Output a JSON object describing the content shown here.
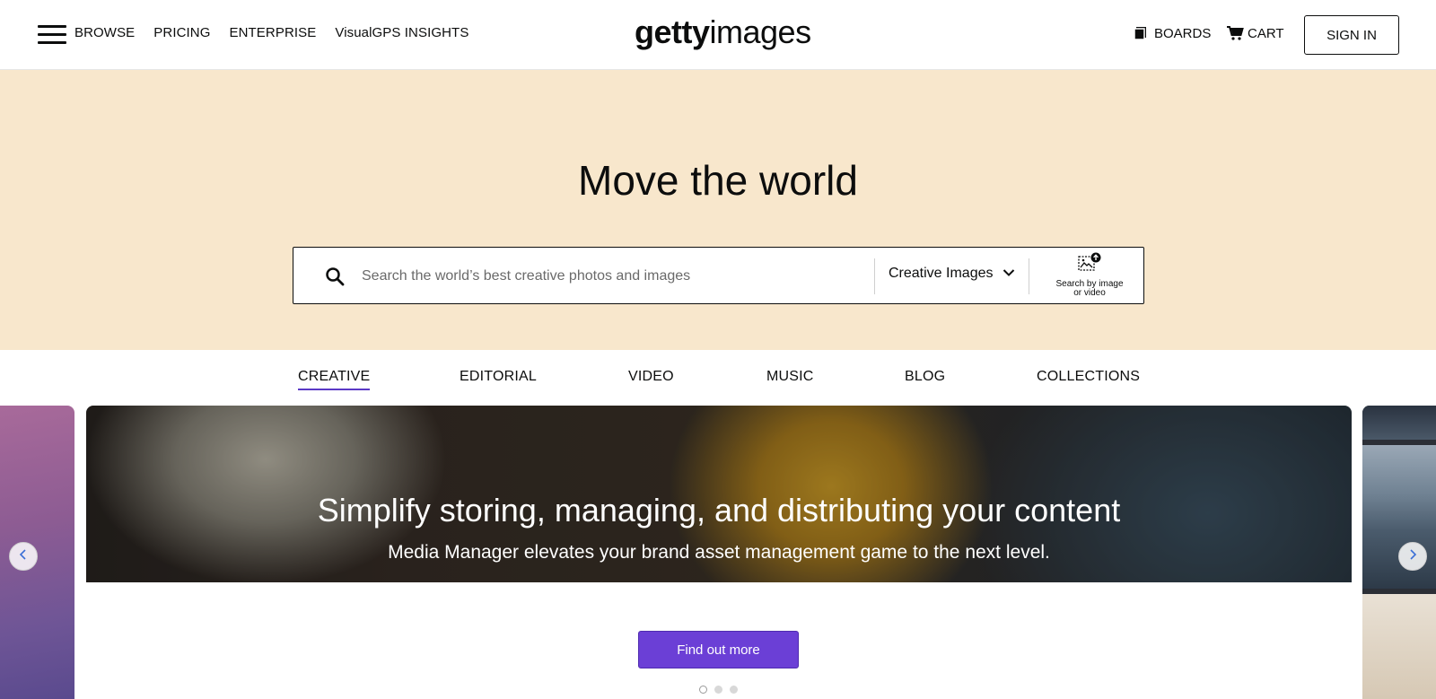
{
  "header": {
    "nav_left": [
      "BROWSE",
      "PRICING",
      "ENTERPRISE",
      "VisualGPS INSIGHTS"
    ],
    "logo_bold": "getty",
    "logo_light": "images",
    "boards_label": "BOARDS",
    "cart_label": "CART",
    "signin_label": "SIGN IN"
  },
  "hero": {
    "title": "Move the world",
    "search_placeholder": "Search the world’s best creative photos and images",
    "search_type": "Creative Images",
    "image_search_line1": "Search by image",
    "image_search_line2": "or video"
  },
  "tabs": [
    "CREATIVE",
    "EDITORIAL",
    "VIDEO",
    "MUSIC",
    "BLOG",
    "COLLECTIONS"
  ],
  "carousel": {
    "title": "Simplify storing, managing, and distributing your content",
    "subtitle": "Media Manager elevates your brand asset management game to the next level.",
    "cta": "Find out more",
    "slide_count": 3,
    "active_slide": 1
  },
  "colors": {
    "hero_bg": "#f8e7cc",
    "accent": "#6b3fd6",
    "tab_underline": "#5b39c6"
  }
}
